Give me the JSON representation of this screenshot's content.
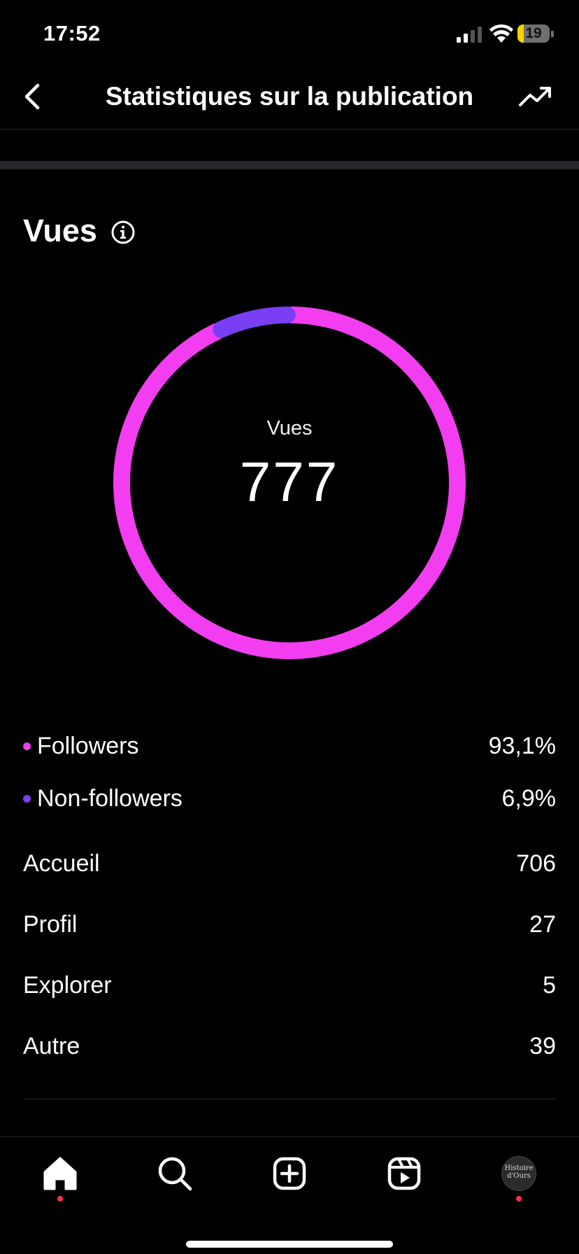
{
  "status_bar": {
    "time": "17:52",
    "battery_level": "19",
    "battery_fraction": 0.19,
    "icons": [
      "signal-icon",
      "wifi-icon",
      "battery-icon"
    ]
  },
  "header": {
    "title": "Statistiques sur la publication",
    "back_icon": "chevron-left-icon",
    "trend_icon": "trending-up-icon"
  },
  "section": {
    "title": "Vues",
    "info_icon": "info-icon"
  },
  "donut": {
    "label": "Vues",
    "total": "777",
    "segments": [
      {
        "name": "Followers",
        "percent": 93.1,
        "color": "#f23ef0"
      },
      {
        "name": "Non-followers",
        "percent": 6.9,
        "color": "#7a3ef5"
      }
    ]
  },
  "legend": [
    {
      "label": "Followers",
      "value": "93,1%",
      "color": "#f23ef0"
    },
    {
      "label": "Non-followers",
      "value": "6,9%",
      "color": "#7a3ef5"
    }
  ],
  "stats": [
    {
      "label": "Accueil",
      "value": "706"
    },
    {
      "label": "Profil",
      "value": "27"
    },
    {
      "label": "Explorer",
      "value": "5"
    },
    {
      "label": "Autre",
      "value": "39"
    }
  ],
  "bottom_nav": {
    "items": [
      "home-icon",
      "search-icon",
      "create-icon",
      "reels-icon",
      "profile-avatar"
    ],
    "avatar_text_line1": "Histoire",
    "avatar_text_line2": "d'Ours",
    "notification_color": "#ff2d55"
  },
  "colors": {
    "background": "#000000",
    "followers": "#f23ef0",
    "non_followers": "#7a3ef5"
  }
}
